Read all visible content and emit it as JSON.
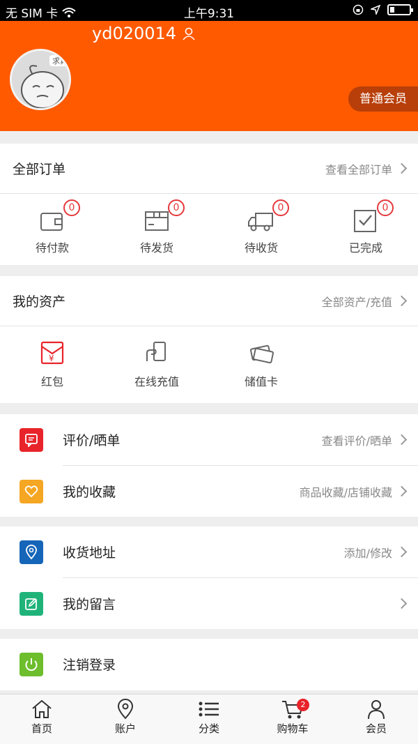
{
  "status_bar": {
    "carrier": "无 SIM 卡",
    "time": "上午9:31"
  },
  "profile": {
    "username": "yd020014",
    "avatar_tag": "求真",
    "member_level": "普通会员"
  },
  "orders": {
    "title": "全部订单",
    "link": "查看全部订单",
    "items": [
      {
        "label": "待付款",
        "count": "0",
        "icon": "wallet-icon"
      },
      {
        "label": "待发货",
        "count": "0",
        "icon": "package-icon"
      },
      {
        "label": "待收货",
        "count": "0",
        "icon": "truck-icon"
      },
      {
        "label": "已完成",
        "count": "0",
        "icon": "check-box-icon"
      }
    ]
  },
  "assets": {
    "title": "我的资产",
    "link": "全部资产/充值",
    "items": [
      {
        "label": "红包",
        "icon": "red-envelope-icon"
      },
      {
        "label": "在线充值",
        "icon": "recharge-icon"
      },
      {
        "label": "储值卡",
        "icon": "stored-value-card-icon"
      }
    ]
  },
  "menu": {
    "review": {
      "title": "评价/晒单",
      "link": "查看评价/晒单",
      "color": "#e8232a"
    },
    "favorites": {
      "title": "我的收藏",
      "link": "商品收藏/店铺收藏",
      "color": "#f5a623"
    },
    "address": {
      "title": "收货地址",
      "link": "添加/修改",
      "color": "#1565b8"
    },
    "messages": {
      "title": "我的留言",
      "link": "",
      "color": "#1fb37a"
    },
    "logout": {
      "title": "注销登录",
      "color": "#6dbd2c"
    }
  },
  "tabbar": {
    "items": [
      {
        "label": "首页",
        "icon": "home-icon"
      },
      {
        "label": "账户",
        "icon": "location-pin-icon"
      },
      {
        "label": "分类",
        "icon": "list-icon"
      },
      {
        "label": "购物车",
        "icon": "cart-icon",
        "badge": "2"
      },
      {
        "label": "会员",
        "icon": "person-icon"
      }
    ]
  },
  "colors": {
    "brand": "#ff5a00",
    "badge": "#e5383b"
  }
}
